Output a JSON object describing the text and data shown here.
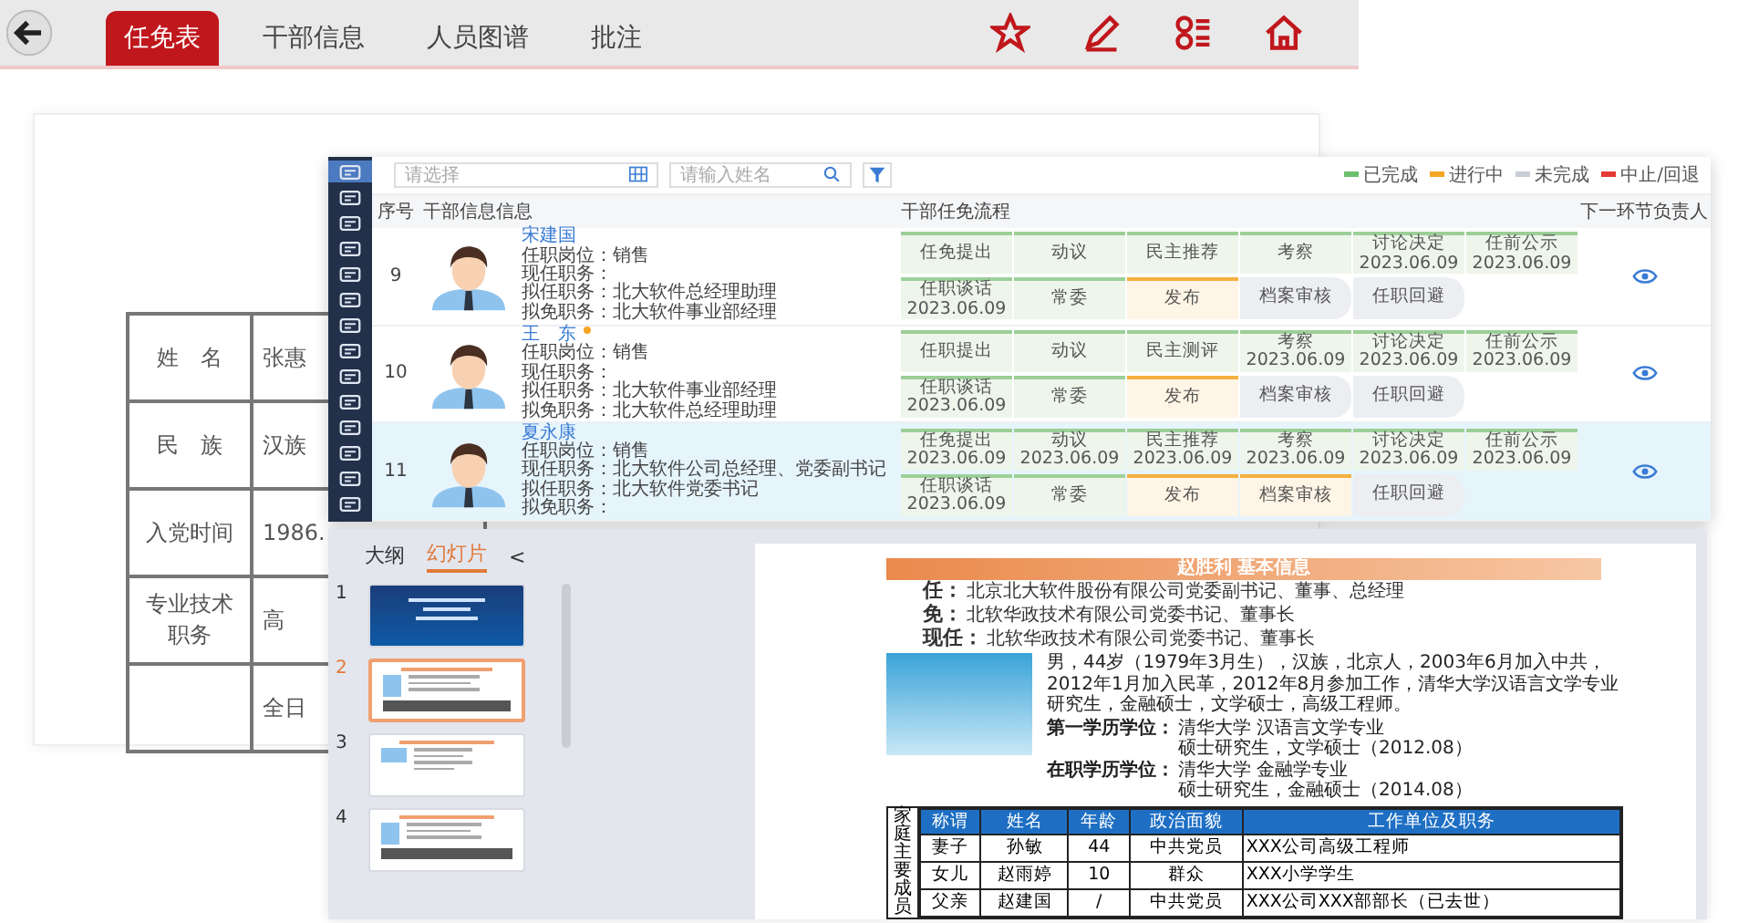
{
  "top_bar": {
    "tabs": [
      {
        "label": "任免表",
        "selected": true
      },
      {
        "label": "干部信息",
        "selected": false
      },
      {
        "label": "人员图谱",
        "selected": false
      },
      {
        "label": "批注",
        "selected": false
      }
    ]
  },
  "background_document": {
    "rows": [
      {
        "label": "姓　名",
        "value": "张惠"
      },
      {
        "label": "民　族",
        "value": "汉族"
      },
      {
        "label": "入党时间",
        "value": "1986."
      },
      {
        "label": "专业技术职务",
        "value": "高"
      },
      {
        "label": "",
        "value": "全日"
      }
    ]
  },
  "cadre_list": {
    "sidebar": {
      "items": [
        {
          "selected": true
        },
        {
          "selected": false
        },
        {
          "selected": false
        },
        {
          "selected": false
        },
        {
          "selected": false
        },
        {
          "selected": false
        },
        {
          "selected": false
        },
        {
          "selected": false
        },
        {
          "selected": false
        },
        {
          "selected": false
        },
        {
          "selected": false
        },
        {
          "selected": false
        },
        {
          "selected": false
        },
        {
          "selected": false
        }
      ]
    },
    "search": {
      "placeholder": "请选择"
    },
    "name_search": {
      "placeholder": "请输入姓名"
    },
    "legend": [
      {
        "label": "已完成",
        "color": "#6cbf6c"
      },
      {
        "label": "进行中",
        "color": "#f5a623"
      },
      {
        "label": "未完成",
        "color": "#c8cdd6"
      },
      {
        "label": "中止/回退",
        "color": "#e53935"
      }
    ],
    "columns": [
      "序号",
      "干部信息信息",
      "干部任免流程",
      "下一环节负责人"
    ],
    "rows": [
      {
        "index": "9",
        "name": "宋建国",
        "starred": false,
        "selected": false,
        "details": [
          "任职岗位：销售",
          "现任职务：",
          "拟任职务：北大软件总经理助理",
          "拟免职务：北大软件事业部经理"
        ],
        "steps": [
          [
            {
              "label": "任免提出",
              "kind": "done"
            },
            {
              "label": "动议",
              "kind": "done"
            },
            {
              "label": "民主推荐",
              "kind": "done"
            },
            {
              "label": "考察",
              "kind": "done"
            },
            {
              "label": "讨论决定",
              "date": "2023.06.09",
              "kind": "done"
            },
            {
              "label": "任前公示",
              "date": "2023.06.09",
              "kind": "done"
            }
          ],
          [
            {
              "label": "任职谈话",
              "date": "2023.06.09",
              "kind": "done"
            },
            {
              "label": "常委",
              "kind": "done"
            },
            {
              "label": "发布",
              "kind": "doing"
            },
            {
              "label": "档案审核",
              "kind": "todo"
            },
            {
              "label": "任职回避",
              "kind": "todo"
            }
          ]
        ]
      },
      {
        "index": "10",
        "name": "王　东",
        "starred": true,
        "selected": false,
        "details": [
          "任职岗位：销售",
          "现任职务：",
          "拟任职务：北大软件事业部经理",
          "拟免职务：北大软件总经理助理"
        ],
        "steps": [
          [
            {
              "label": "任职提出",
              "kind": "done"
            },
            {
              "label": "动议",
              "kind": "done"
            },
            {
              "label": "民主测评",
              "kind": "done"
            },
            {
              "label": "考察",
              "date": "2023.06.09",
              "kind": "done"
            },
            {
              "label": "讨论决定",
              "date": "2023.06.09",
              "kind": "done"
            },
            {
              "label": "任前公示",
              "date": "2023.06.09",
              "kind": "done"
            }
          ],
          [
            {
              "label": "任职谈话",
              "date": "2023.06.09",
              "kind": "done"
            },
            {
              "label": "常委",
              "kind": "done"
            },
            {
              "label": "发布",
              "kind": "doing"
            },
            {
              "label": "档案审核",
              "kind": "todo"
            },
            {
              "label": "任职回避",
              "kind": "todo"
            }
          ]
        ]
      },
      {
        "index": "11",
        "name": "夏永康",
        "starred": false,
        "selected": true,
        "details": [
          "任职岗位：销售",
          "现任职务：北大软件公司总经理、党委副书记",
          "拟任职务：北大软件党委书记",
          "拟免职务："
        ],
        "steps": [
          [
            {
              "label": "任免提出",
              "date": "2023.06.09",
              "kind": "done"
            },
            {
              "label": "动议",
              "date": "2023.06.09",
              "kind": "done"
            },
            {
              "label": "民主推荐",
              "date": "2023.06.09",
              "kind": "done"
            },
            {
              "label": "考察",
              "date": "2023.06.09",
              "kind": "done"
            },
            {
              "label": "讨论决定",
              "date": "2023.06.09",
              "kind": "done"
            },
            {
              "label": "任前公示",
              "date": "2023.06.09",
              "kind": "done"
            }
          ],
          [
            {
              "label": "任职谈话",
              "date": "2023.06.09",
              "kind": "done"
            },
            {
              "label": "常委",
              "kind": "done"
            },
            {
              "label": "发布",
              "kind": "doing"
            },
            {
              "label": "档案审核",
              "kind": "doing"
            },
            {
              "label": "任职回避",
              "kind": "todo"
            }
          ]
        ]
      }
    ]
  },
  "slides_panel": {
    "tabs": [
      {
        "label": "大纲",
        "selected": false
      },
      {
        "label": "幻灯片",
        "selected": true
      }
    ],
    "collapse": "<",
    "slides": [
      {
        "number": "1",
        "selected": false,
        "kind": "cover"
      },
      {
        "number": "2",
        "selected": true,
        "kind": "profile"
      },
      {
        "number": "3",
        "selected": false,
        "kind": "list"
      },
      {
        "number": "4",
        "selected": false,
        "kind": "profile"
      }
    ]
  },
  "slide": {
    "title": "赵胜利 基本信息",
    "appointments": [
      {
        "label": "任：",
        "text": "北京北大软件股份有限公司党委副书记、董事、总经理"
      },
      {
        "label": "免：",
        "text": "北软华政技术有限公司党委书记、董事长"
      },
      {
        "label": "现任：",
        "text": "北软华政技术有限公司党委书记、董事长"
      }
    ],
    "bio": "男，44岁（1979年3月生），汉族，北京人，2003年6月加入中共，2012年1月加入民革，2012年8月参加工作，清华大学汉语言文学专业研究生，金融硕士，文学硕士，高级工程师。",
    "education": [
      {
        "label": "第一学历学位：",
        "lines": [
          "清华大学 汉语言文学专业",
          "硕士研究生，文学硕士（2012.08）"
        ]
      },
      {
        "label": "在职学历学位：",
        "lines": [
          "清华大学 金融学专业",
          "硕士研究生，金融硕士（2014.08）"
        ]
      }
    ],
    "family": {
      "side_label": "家庭主要成员",
      "columns": [
        "称谓",
        "姓名",
        "年龄",
        "政治面貌",
        "工作单位及职务"
      ],
      "rows": [
        [
          "妻子",
          "孙敏",
          "44",
          "中共党员",
          "XXX公司高级工程师"
        ],
        [
          "女儿",
          "赵雨婷",
          "10",
          "群众",
          "XXX小学学生"
        ],
        [
          "父亲",
          "赵建国",
          "/",
          "中共党员",
          "XXX公司XXX部部长（已去世）"
        ]
      ]
    }
  }
}
